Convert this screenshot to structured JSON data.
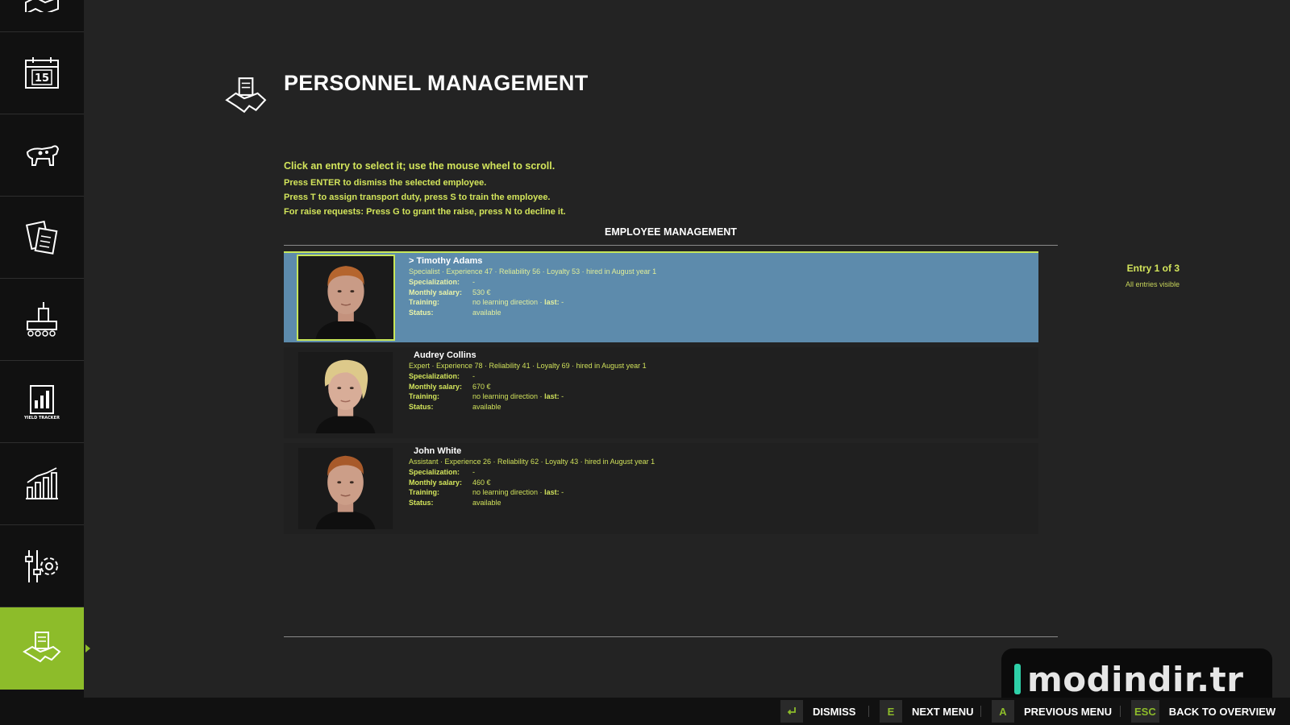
{
  "sidebar": {
    "items": [
      {
        "icon": "map-icon"
      },
      {
        "icon": "calendar-icon",
        "text": "15"
      },
      {
        "icon": "cow-icon"
      },
      {
        "icon": "documents-icon"
      },
      {
        "icon": "production-icon"
      },
      {
        "icon": "yield-tracker-icon",
        "text": "YIELD TRACKER"
      },
      {
        "icon": "statistics-icon"
      },
      {
        "icon": "settings-icon"
      },
      {
        "icon": "handshake-icon",
        "active": true
      }
    ]
  },
  "header": {
    "title": "PERSONNEL MANAGEMENT",
    "icon": "handshake-icon"
  },
  "instructions": {
    "line1": "Click an entry to select it; use the mouse wheel to scroll.",
    "line2": "Press ENTER to dismiss the selected employee.",
    "line3": "Press T to assign transport duty, press S to train the employee.",
    "line4": "For raise requests: Press G to grant the raise, press N to decline it."
  },
  "section_title": "EMPLOYEE MANAGEMENT",
  "labels": {
    "specialization": "Specialization:",
    "salary": "Monthly salary:",
    "training": "Training:",
    "status": "Status:",
    "last": "last:"
  },
  "employees": [
    {
      "name": "> Timothy Adams",
      "summary": "Specialist · Experience 47 · Reliability 56 · Loyalty 53 · hired in August year 1",
      "specialization": "-",
      "salary": "530 €",
      "training": "no learning direction ·",
      "training_last": "-",
      "status": "available",
      "selected": true,
      "hair": "#b5652e",
      "skin": "#c99b86"
    },
    {
      "name": "Audrey Collins",
      "summary": "Expert · Experience 78 · Reliability 41 · Loyalty 69 · hired in August year 1",
      "specialization": "-",
      "salary": "670 €",
      "training": "no learning direction ·",
      "training_last": "-",
      "status": "available",
      "selected": false,
      "hair": "#ddc98a",
      "skin": "#d8ad98"
    },
    {
      "name": "John White",
      "summary": "Assistant · Experience 26 · Reliability 62 · Loyalty 43 · hired in August year 1",
      "specialization": "-",
      "salary": "460 €",
      "training": "no learning direction ·",
      "training_last": "-",
      "status": "available",
      "selected": false,
      "hair": "#a85a2a",
      "skin": "#cc9e88"
    }
  ],
  "entry": {
    "count": "Entry 1 of 3",
    "note": "All entries visible"
  },
  "footer": {
    "dismiss": {
      "key": "enter-icon",
      "label": "DISMISS"
    },
    "next": {
      "key": "E",
      "label": "NEXT MENU"
    },
    "prev": {
      "key": "A",
      "label": "PREVIOUS MENU"
    },
    "back": {
      "key": "ESC",
      "label": "BACK TO OVERVIEW"
    }
  },
  "watermark": {
    "text": "modindir.tr"
  },
  "colors": {
    "accent": "#8dbc2a",
    "text_yellow": "#d3e55b",
    "selected_row": "#5d8bac"
  }
}
